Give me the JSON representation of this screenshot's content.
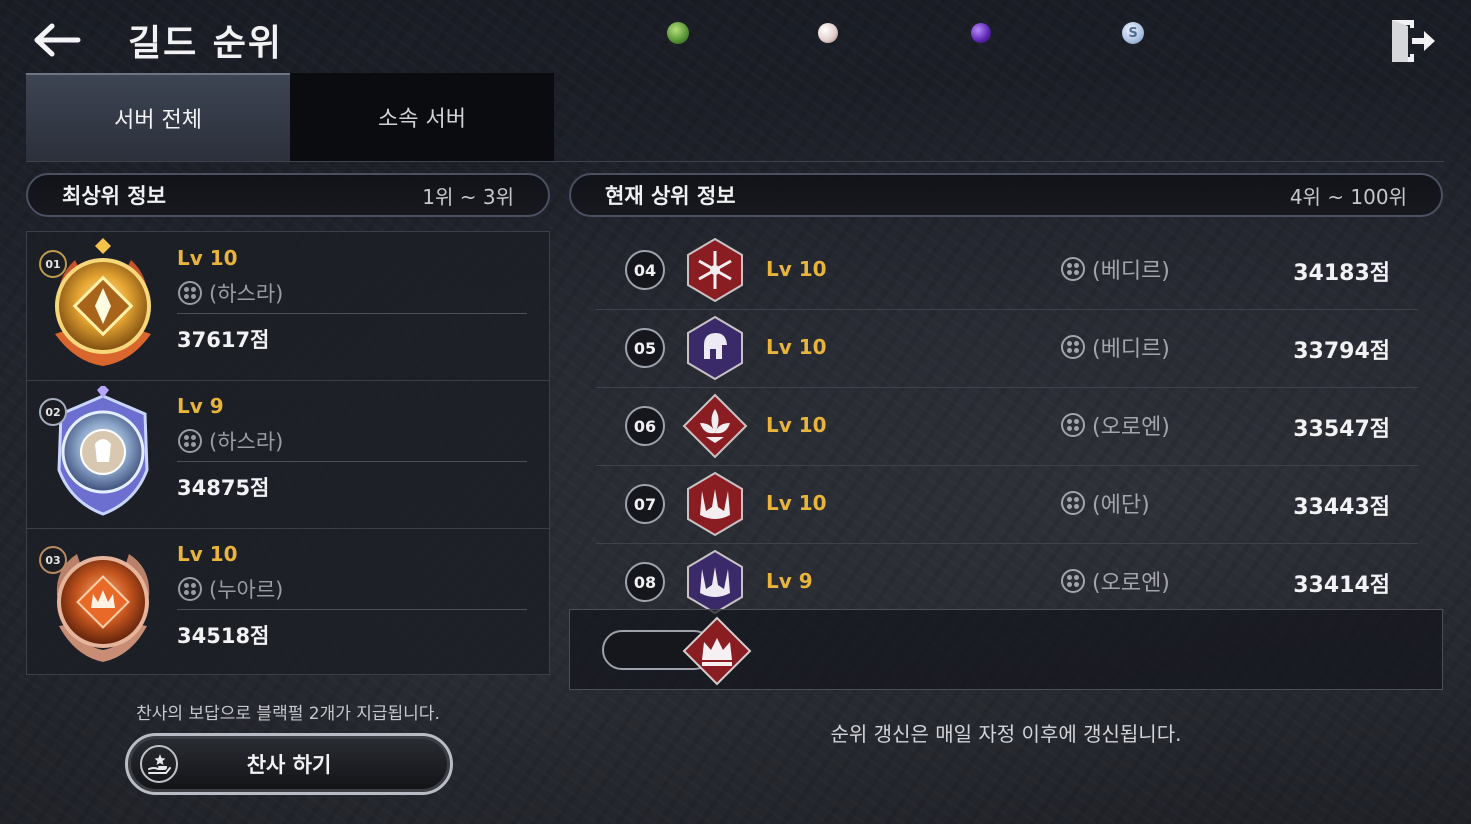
{
  "header": {
    "title": "길드 순위"
  },
  "currencies": [
    {
      "icon": "green-gem-icon",
      "color": "#6fae4a"
    },
    {
      "icon": "white-pearl-icon",
      "color": "#e8d6d2"
    },
    {
      "icon": "purple-orb-icon",
      "color": "#6a2fc2"
    },
    {
      "icon": "silver-coin-icon",
      "color": "#b8cce8"
    }
  ],
  "tabs": [
    {
      "label": "서버 전체",
      "active": true
    },
    {
      "label": "소속 서버",
      "active": false
    }
  ],
  "top_section": {
    "title": "최상위 정보",
    "range": "1위 ~ 3위",
    "entries": [
      {
        "rank": "01",
        "level": "Lv 10",
        "server": "(하스라)",
        "score": "37617점",
        "emblem": "gold-emblem-icon"
      },
      {
        "rank": "02",
        "level": "Lv 9",
        "server": "(하스라)",
        "score": "34875점",
        "emblem": "silver-emblem-icon"
      },
      {
        "rank": "03",
        "level": "Lv 10",
        "server": "(누아르)",
        "score": "34518점",
        "emblem": "bronze-emblem-icon"
      }
    ]
  },
  "current_section": {
    "title": "현재 상위 정보",
    "range": "4위 ~ 100위",
    "entries": [
      {
        "rank": "04",
        "level": "Lv 10",
        "server": "(베디르)",
        "score": "34183점",
        "crest": "snowflake-crest-icon",
        "crest_color": "#8a1d22"
      },
      {
        "rank": "05",
        "level": "Lv 10",
        "server": "(베디르)",
        "score": "33794점",
        "crest": "helmet-crest-icon",
        "crest_color": "#3a2a6a"
      },
      {
        "rank": "06",
        "level": "Lv 10",
        "server": "(오로엔)",
        "score": "33547점",
        "crest": "lotus-crest-icon",
        "crest_color": "#8a1d22"
      },
      {
        "rank": "07",
        "level": "Lv 10",
        "server": "(에단)",
        "score": "33443점",
        "crest": "trident-crest-icon",
        "crest_color": "#8a1d22"
      },
      {
        "rank": "08",
        "level": "Lv 9",
        "server": "(오로엔)",
        "score": "33414점",
        "crest": "trident-crest-icon",
        "crest_color": "#3a2a6a"
      }
    ]
  },
  "my_guild": {
    "crest": "crown-crest-icon"
  },
  "footer": {
    "reward_note": "찬사의 보답으로 블랙펄 2개가 지급됩니다.",
    "cheer_button": "찬사 하기",
    "update_note": "순위 갱신은 매일 자정 이후에 갱신됩니다."
  }
}
